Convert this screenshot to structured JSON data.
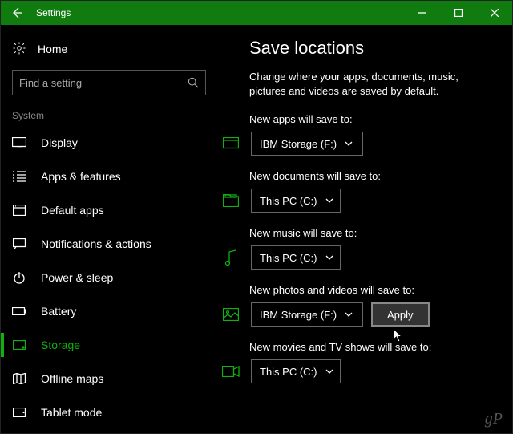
{
  "titlebar": {
    "title": "Settings"
  },
  "sidebar": {
    "home": "Home",
    "search_placeholder": "Find a setting",
    "section": "System",
    "items": [
      {
        "label": "Display"
      },
      {
        "label": "Apps & features"
      },
      {
        "label": "Default apps"
      },
      {
        "label": "Notifications & actions"
      },
      {
        "label": "Power & sleep"
      },
      {
        "label": "Battery"
      },
      {
        "label": "Storage"
      },
      {
        "label": "Offline maps"
      },
      {
        "label": "Tablet mode"
      }
    ]
  },
  "main": {
    "title": "Save locations",
    "description": "Change where your apps, documents, music, pictures and videos are saved by default.",
    "apply_label": "Apply",
    "settings": [
      {
        "label": "New apps will save to:",
        "value": "IBM Storage (F:)"
      },
      {
        "label": "New documents will save to:",
        "value": "This PC (C:)"
      },
      {
        "label": "New music will save to:",
        "value": "This PC (C:)"
      },
      {
        "label": "New photos and videos will save to:",
        "value": "IBM Storage (F:)"
      },
      {
        "label": "New movies and TV shows will save to:",
        "value": "This PC (C:)"
      }
    ]
  },
  "watermark": "gP"
}
